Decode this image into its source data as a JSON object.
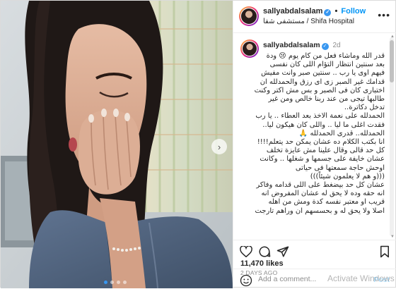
{
  "header": {
    "username": "sallyabdalsalam",
    "verified_icon": "verified-badge-icon",
    "separator": "•",
    "follow_label": "Follow",
    "location": "مستشفى شفا / Shifa Hospital",
    "more_icon": "more-options-icon"
  },
  "caption": {
    "username": "sallyabdalsalam",
    "time": "2d",
    "text": "قدر الله وماشاء فعل من كام يوم 😢 ودة\nبعد سنتين انتظار التؤام اللى كان نفسى\nفيهم اوى يا رب .. سنتين صبر وانت مفيش\nقدامك غير الصبر زى اى رزق والحمدلله ان\nاختبارى كان فى الصبر و بس مش اكتر وكنت\nطالبها تيجى من عند ربنا خالص ومن غير\nتدخل دكاترة..\nالحمدلله على نعمة الاخذ بعد العطاء .. يا رب\nفقدت اغلى ما ليا .. واللى كان هيكون ليا..\nالحمدلله.. قدرى الحمدلله 🙏\nانا بكتب الكلام ده عشان يمكن حد يتعلم!!!!\nكل حد قالى وقال علينا مش عايزة تخلف\nعشان خايفة على جسمها و شغلها .. وكانت\nاوحش حاجة سمعتها فى حياتى\n(((و هم لا يعلمون شيئاً)))\nعشان كل حد بيضغط على اللى قدامه وفاكر\nانه حقه وده لا يحق له عشان المفروض انه\nقريب او معتبر نفسه كدة ومش من اهله\nاصلا ولا يحق له و بحسسهم ان وراهم تارجت"
  },
  "actions": {
    "like_icon": "heart-icon",
    "comment_icon": "comment-icon",
    "share_icon": "share-icon",
    "save_icon": "bookmark-icon"
  },
  "likes": "11,470 likes",
  "posted_ago": "2 DAYS AGO",
  "comment": {
    "emoji_icon": "smiley-icon",
    "placeholder": "Add a comment...",
    "post_label": "Post"
  },
  "carousel": {
    "total": 4,
    "active": 0
  },
  "watermark": "Activate Windows",
  "colors": {
    "accent": "#0095f6",
    "verified": "#3897f0",
    "post_disabled": "#b2dffc"
  }
}
